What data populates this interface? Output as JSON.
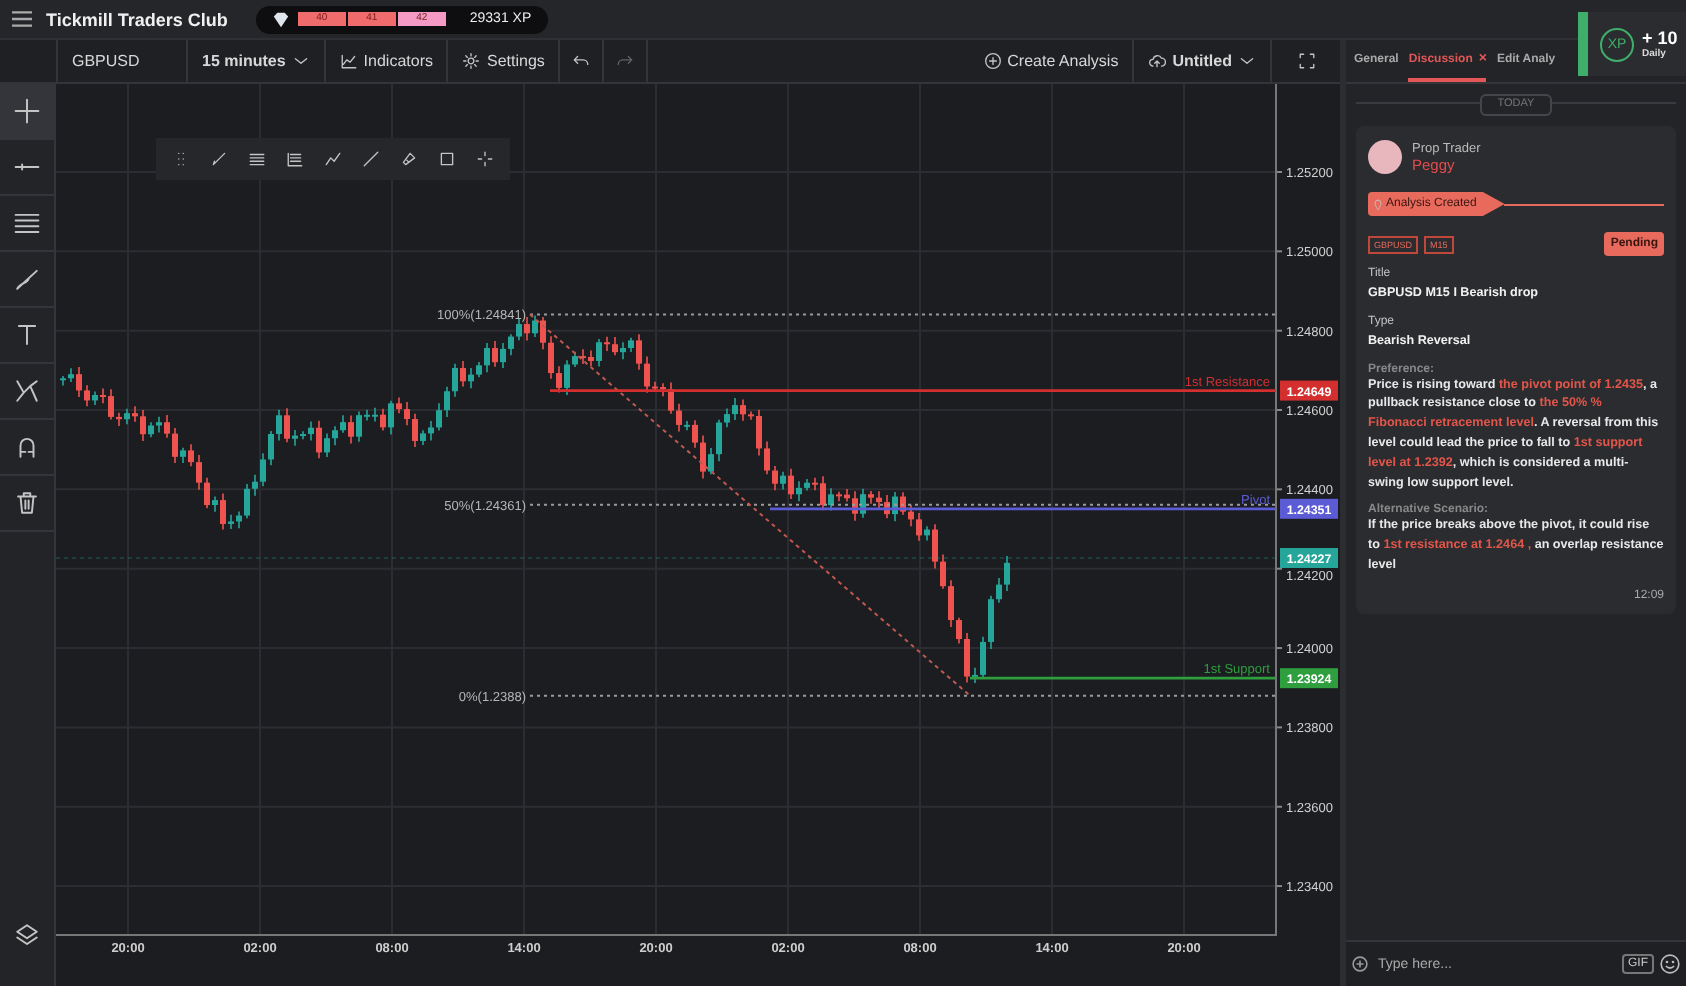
{
  "app_bar": {
    "title": "Tickmill Traders Club",
    "level_segments": [
      {
        "label": "40",
        "color": "#f06b6b"
      },
      {
        "label": "41",
        "color": "#f06b6b"
      },
      {
        "label": "42",
        "color": "#f59ac4"
      }
    ],
    "xp": "29331 XP"
  },
  "xp_toast": {
    "badge": "XP",
    "amount": "+ 10",
    "caption": "Daily"
  },
  "toolbar": {
    "symbol": "GBPUSD",
    "interval": "15 minutes",
    "indicators": "Indicators",
    "settings": "Settings",
    "create": "Create Analysis",
    "analysis_name": "Untitled"
  },
  "tools": [
    {
      "kind": "crosshair",
      "selected": true
    },
    {
      "kind": "line",
      "selected": false
    },
    {
      "kind": "hlines",
      "selected": false
    },
    {
      "kind": "brush",
      "selected": false
    },
    {
      "kind": "text",
      "selected": false
    },
    {
      "kind": "pattern",
      "selected": false
    },
    {
      "kind": "magnet",
      "selected": false
    },
    {
      "kind": "trash",
      "selected": false
    }
  ],
  "chart": {
    "price_ticks": [
      "1.25200",
      "1.25000",
      "1.24800",
      "1.24600",
      "1.24400",
      "1.24200",
      "1.24000",
      "1.23800",
      "1.23600",
      "1.23400"
    ],
    "time_ticks": [
      "20:00",
      "02:00",
      "08:00",
      "14:00",
      "20:00",
      "02:00",
      "08:00",
      "14:00",
      "20:00"
    ],
    "fib_levels": [
      "100%(1.24841)",
      "50%(1.24361)",
      "0%(1.2388)"
    ],
    "lines": [
      {
        "kind": "resistance",
        "label": "1st Resistance",
        "value": "1.24649",
        "color": "#d32f2f"
      },
      {
        "kind": "pivot",
        "label": "Pivot",
        "value": "1.24351",
        "color": "#5b5bd6"
      },
      {
        "kind": "current",
        "value": "1.24227",
        "color": "#26a69a"
      },
      {
        "kind": "support",
        "label": "1st Support",
        "value": "1.23924",
        "color": "#2e9e3e"
      }
    ]
  },
  "panel": {
    "tabs": [
      {
        "label": "General",
        "selected": false
      },
      {
        "label": "Discussion",
        "selected": true,
        "close": "×"
      },
      {
        "label": "Edit Analy",
        "selected": false
      }
    ],
    "date_divider": "TODAY",
    "message": {
      "role": "Prop Trader",
      "author": "Peggy",
      "event": "Analysis Created",
      "tags": [
        "GBPUSD",
        "M15"
      ],
      "status": "Pending",
      "fields": [
        {
          "kind": "short",
          "label": "Title",
          "value": "GBPUSD M15 I Bearish drop"
        },
        {
          "kind": "short",
          "label": "Type",
          "value": "Bearish Reversal"
        },
        {
          "kind": "paragraph",
          "label": "Preference:",
          "value": "Price is rising toward **the pivot point of 1.2435**, a pullback resistance close to **the 50% % Fibonacci retracement level**. A reversal from this level could lead the price to fall to **1st support level at 1.2392**, which is considered a multi-swing low support level."
        },
        {
          "kind": "paragraph",
          "label": "Alternative Scenario:",
          "value": "If the price breaks above the pivot, it could rise to **1st resistance at 1.2464 ,** an overlap  resistance level"
        }
      ],
      "time": "12:09"
    },
    "composer": {
      "placeholder": "Type here...",
      "gif": "GIF"
    }
  }
}
